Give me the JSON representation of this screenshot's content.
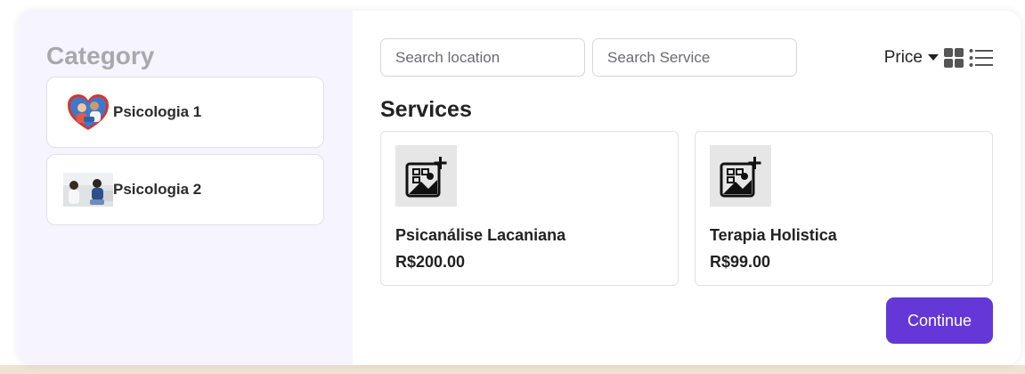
{
  "sidebar": {
    "title": "Category",
    "items": [
      {
        "label": "Psicologia 1",
        "icon": "category-photo-1"
      },
      {
        "label": "Psicologia 2",
        "icon": "category-photo-2"
      }
    ]
  },
  "search": {
    "location_placeholder": "Search location",
    "service_placeholder": "Search Service"
  },
  "toolbar": {
    "price_label": "Price",
    "grid_view_icon": "grid-view-icon",
    "list_view_icon": "list-view-icon"
  },
  "services": {
    "title": "Services",
    "items": [
      {
        "name": "Psicanálise Lacaniana",
        "price": "R$200.00",
        "icon": "image-placeholder-icon"
      },
      {
        "name": "Terapia Holistica",
        "price": "R$99.00",
        "icon": "image-placeholder-icon"
      }
    ]
  },
  "actions": {
    "continue_label": "Continue"
  },
  "colors": {
    "accent": "#6437d6",
    "sidebar_bg": "#f5f4ff",
    "bottom_strip": "#f0e2d2"
  }
}
